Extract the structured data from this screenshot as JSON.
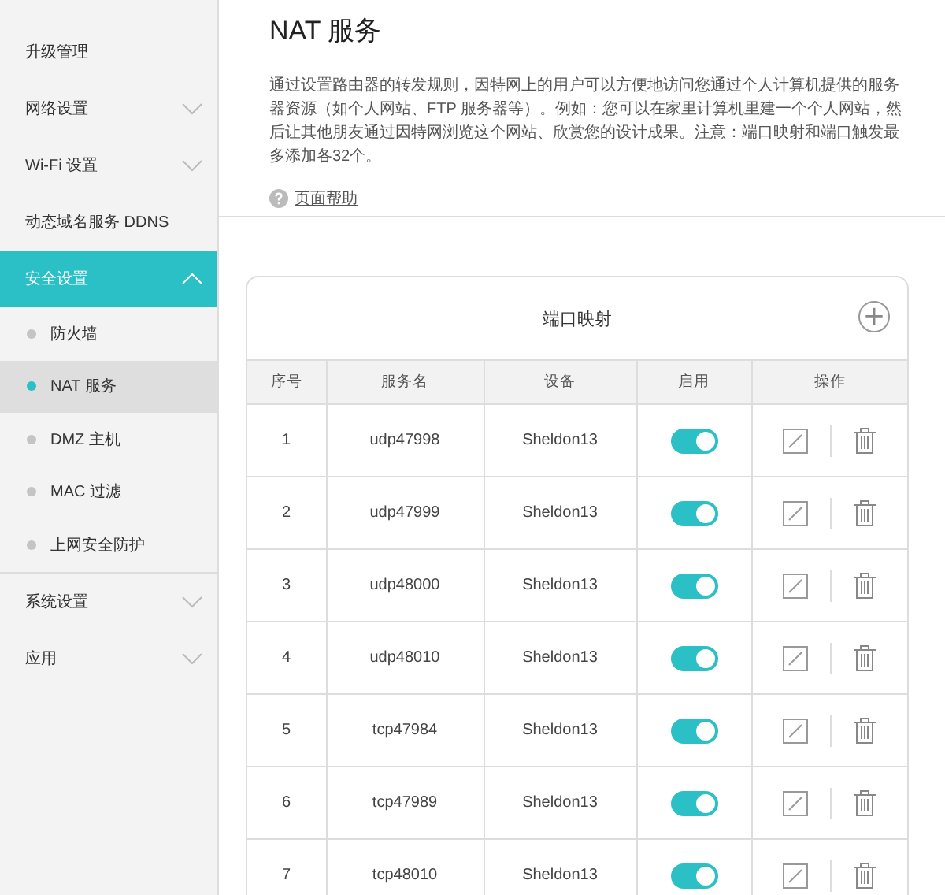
{
  "sidebar": {
    "items": [
      {
        "label": "升级管理",
        "selected": false
      },
      {
        "label": "网络设置",
        "selected": false,
        "expanded": false
      },
      {
        "label": "Wi-Fi 设置",
        "selected": false,
        "expanded": false
      },
      {
        "label": "动态域名服务 DDNS",
        "selected": false
      },
      {
        "label": "安全设置",
        "selected": true,
        "expanded": true,
        "children": [
          {
            "label": "防火墙",
            "selected": false
          },
          {
            "label": "NAT 服务",
            "selected": true
          },
          {
            "label": "DMZ 主机",
            "selected": false
          },
          {
            "label": "MAC 过滤",
            "selected": false
          },
          {
            "label": "上网安全防护",
            "selected": false
          }
        ]
      },
      {
        "label": "系统设置",
        "selected": false,
        "expanded": false
      },
      {
        "label": "应用",
        "selected": false,
        "expanded": false
      }
    ]
  },
  "page": {
    "title": "NAT 服务",
    "description": "通过设置路由器的转发规则，因特网上的用户可以方便地访问您通过个人计算机提供的服务器资源（如个人网站、FTP 服务器等）。例如：您可以在家里计算机里建一个个人网站，然后让其他朋友通过因特网浏览这个网站、欣赏您的设计成果。注意：端口映射和端口触发最多添加各32个。",
    "help_link": "页面帮助"
  },
  "table": {
    "title": "端口映射",
    "add_button": "+",
    "columns": [
      "序号",
      "服务名",
      "设备",
      "启用",
      "操作"
    ],
    "rows": [
      {
        "number": "1",
        "service": "udp47998",
        "device": "Sheldon13",
        "enabled": true
      },
      {
        "number": "2",
        "service": "udp47999",
        "device": "Sheldon13",
        "enabled": true
      },
      {
        "number": "3",
        "service": "udp48000",
        "device": "Sheldon13",
        "enabled": true
      },
      {
        "number": "4",
        "service": "udp48010",
        "device": "Sheldon13",
        "enabled": true
      },
      {
        "number": "5",
        "service": "tcp47984",
        "device": "Sheldon13",
        "enabled": true
      },
      {
        "number": "6",
        "service": "tcp47989",
        "device": "Sheldon13",
        "enabled": true
      },
      {
        "number": "7",
        "service": "tcp48010",
        "device": "Sheldon13",
        "enabled": true
      }
    ]
  }
}
